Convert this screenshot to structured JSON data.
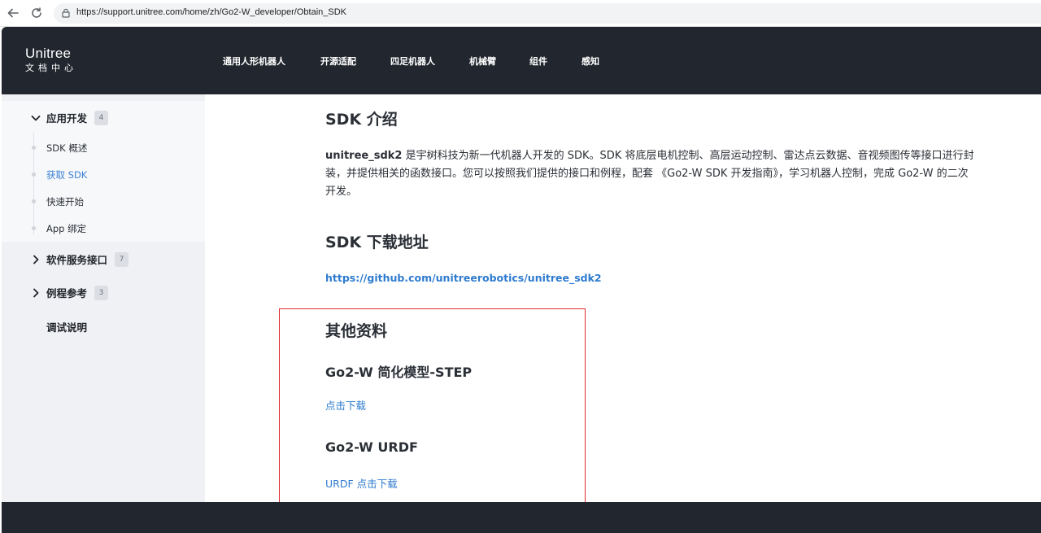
{
  "browser": {
    "url": "https://support.unitree.com/home/zh/Go2-W_developer/Obtain_SDK"
  },
  "header": {
    "logo_main": "Unitree",
    "logo_sub": "文档中心",
    "nav": [
      "通用人形机器人",
      "开源适配",
      "四足机器人",
      "机械臂",
      "组件",
      "感知"
    ]
  },
  "sidebar": {
    "groups": [
      {
        "label": "应用开发",
        "count": "4",
        "expanded": true
      },
      {
        "label": "软件服务接口",
        "count": "7",
        "expanded": false
      },
      {
        "label": "例程参考",
        "count": "3",
        "expanded": false
      }
    ],
    "sub_items": [
      "SDK 概述",
      "获取 SDK",
      "快速开始",
      "App 绑定"
    ],
    "active_sub_item": "获取 SDK",
    "plain_item": "调试说明"
  },
  "main": {
    "intro_heading": "SDK 介绍",
    "intro_strong": "unitree_sdk2",
    "intro_line1": " 是宇树科技为新一代机器人开发的 SDK。SDK 将底层电机控制、高层运动控制、雷达点云数据、音视频图传等接口进行封",
    "intro_line2": "装，并提供相关的函数接口。您可以按照我们提供的接口和例程，配套 《Go2-W SDK 开发指南》，学习机器人控制，完成 Go2-W 的二次",
    "intro_line3": "开发。",
    "download_heading": "SDK 下载地址",
    "download_link": "https://github.com/unitreerobotics/unitree_sdk2",
    "other_heading": "其他资料",
    "step_heading": "Go2-W 简化模型-STEP",
    "step_link": "点击下载",
    "urdf_heading": "Go2-W URDF",
    "urdf_link": "URDF 点击下载"
  },
  "colors": {
    "header_bg": "#22262e",
    "link": "#2e7bcf",
    "active": "#3b82d6",
    "highlight_border": "#e0292b",
    "sidebar_bg": "#f0f1f4"
  }
}
